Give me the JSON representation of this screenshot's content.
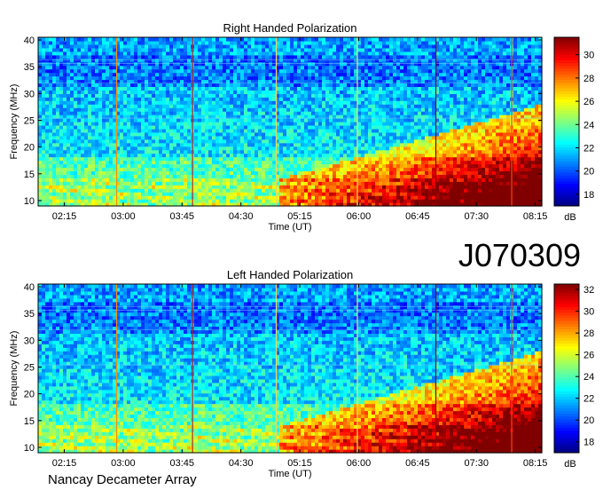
{
  "header": {
    "observation_id": "J070309"
  },
  "footer": {
    "instrument": "Nancay Decameter Array"
  },
  "chart_data": [
    {
      "type": "heatmap",
      "title": "Right Handed Polarization",
      "xlabel": "Time (UT)",
      "ylabel": "Frequency (MHz)",
      "x_ticks": [
        "02:15",
        "03:00",
        "03:45",
        "04:30",
        "05:15",
        "06:00",
        "06:45",
        "07:30",
        "08:15"
      ],
      "x_range": [
        "01:55",
        "08:20"
      ],
      "y_ticks": [
        10,
        15,
        20,
        25,
        30,
        35,
        40
      ],
      "ylim": [
        9,
        40.5
      ],
      "colorbar": {
        "label": "dB",
        "ticks": [
          18,
          20,
          22,
          24,
          26,
          28,
          30
        ],
        "range": [
          17,
          31.5
        ],
        "colormap": "jet"
      },
      "vertical_lines_ut": [
        "02:55",
        "03:53",
        "04:57",
        "05:59",
        "06:59",
        "07:57"
      ],
      "emission_onset_ut": "05:00",
      "grid": false
    },
    {
      "type": "heatmap",
      "title": "Left Handed Polarization",
      "xlabel": "Time (UT)",
      "ylabel": "Frequency (MHz)",
      "x_ticks": [
        "02:15",
        "03:00",
        "03:45",
        "04:30",
        "05:15",
        "06:00",
        "06:45",
        "07:30",
        "08:15"
      ],
      "x_range": [
        "01:55",
        "08:20"
      ],
      "y_ticks": [
        10,
        15,
        20,
        25,
        30,
        35,
        40
      ],
      "ylim": [
        9,
        40.5
      ],
      "colorbar": {
        "label": "dB",
        "ticks": [
          18,
          20,
          22,
          24,
          26,
          28,
          30,
          32
        ],
        "range": [
          17,
          32.5
        ],
        "colormap": "jet"
      },
      "vertical_lines_ut": [
        "02:55",
        "03:53",
        "04:57",
        "05:59",
        "06:59",
        "07:57"
      ],
      "emission_onset_ut": "05:00",
      "grid": false
    }
  ]
}
